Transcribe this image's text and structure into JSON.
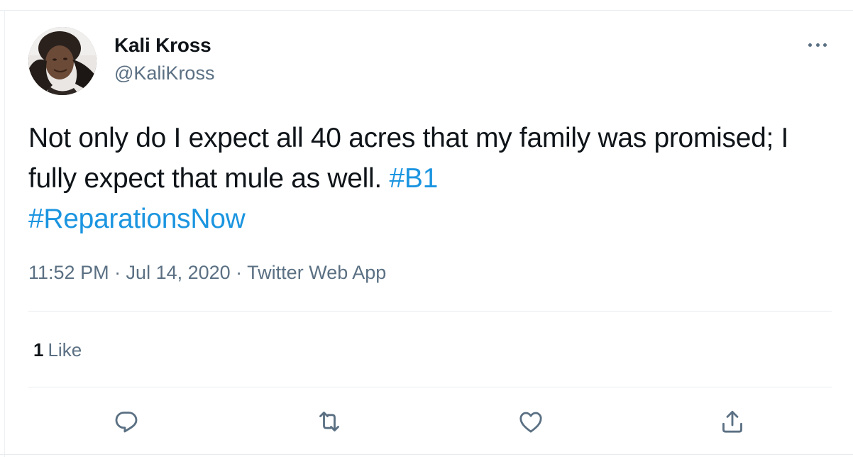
{
  "author": {
    "display_name": "Kali Kross",
    "handle": "@KaliKross"
  },
  "tweet": {
    "text_plain": "Not only do I expect all 40 acres that my family was promised; I fully expect that mule as well. ",
    "hashtags": [
      "#B1",
      "#ReparationsNow"
    ],
    "timestamp": "11:52 PM · Jul 14, 2020 · Twitter Web App"
  },
  "stats": {
    "likes_count": "1",
    "likes_label": "Like"
  },
  "actions": {
    "icons": [
      "reply-icon",
      "retweet-icon",
      "like-icon",
      "share-icon"
    ]
  },
  "colors": {
    "accent": "#1b95e0",
    "secondary_text": "#5b7083",
    "primary_text": "#0f1419",
    "divider": "#e8ecef"
  }
}
